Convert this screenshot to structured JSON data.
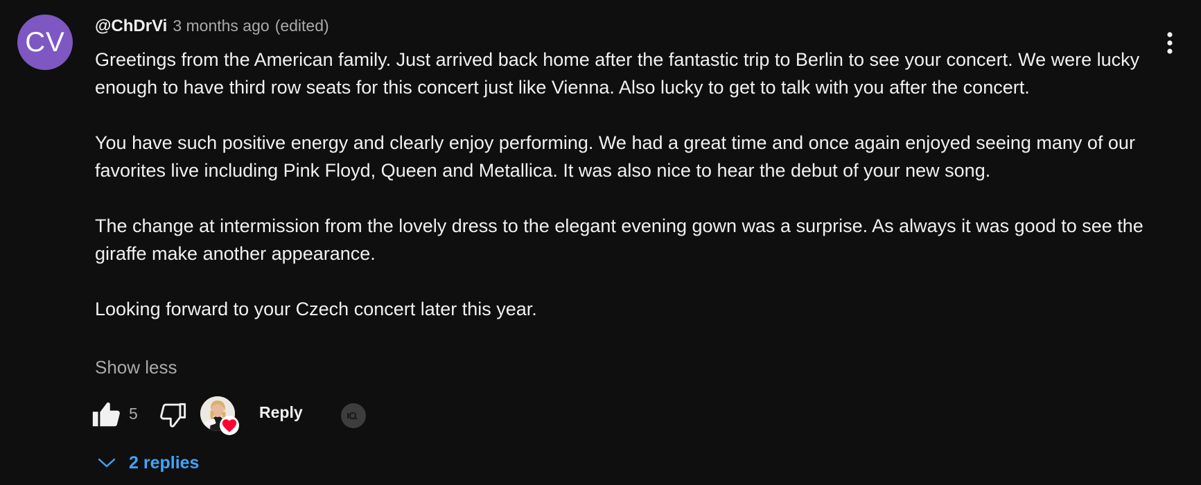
{
  "comment": {
    "avatar_initials": "CV",
    "avatar_color": "#7e57c2",
    "author": "@ChDrVi",
    "timestamp": "3 months ago",
    "edited": "(edited)",
    "paragraphs": [
      "Greetings from the American family.  Just arrived back home after the fantastic trip to Berlin to see your concert.  We were lucky enough to have third row seats for this concert just like Vienna.  Also lucky to get to talk with you after the concert.",
      "You have such positive energy and clearly enjoy performing.  We had a great time and once again enjoyed seeing many of our favorites live including Pink Floyd, Queen and Metallica.  It was also nice to hear the debut of your new song.",
      "The change at intermission from the lovely dress to the elegant evening gown was a surprise.  As always it was good to see the giraffe make another appearance.",
      "Looking forward to your Czech concert later this year."
    ],
    "show_less_label": "Show less",
    "like_count": "5",
    "reply_label": "Reply",
    "replies_label": "2 replies"
  },
  "icons": {
    "menu": "more-vert-icon",
    "like": "thumb-up-icon",
    "dislike": "thumb-down-icon",
    "creator_heart": "heart-icon",
    "replies_toggle": "chevron-down-icon"
  },
  "colors": {
    "background": "#0f0f0f",
    "text": "#f1f1f1",
    "secondary_text": "#aaaaaa",
    "link": "#3ea6ff",
    "heart": "#ff0033"
  }
}
